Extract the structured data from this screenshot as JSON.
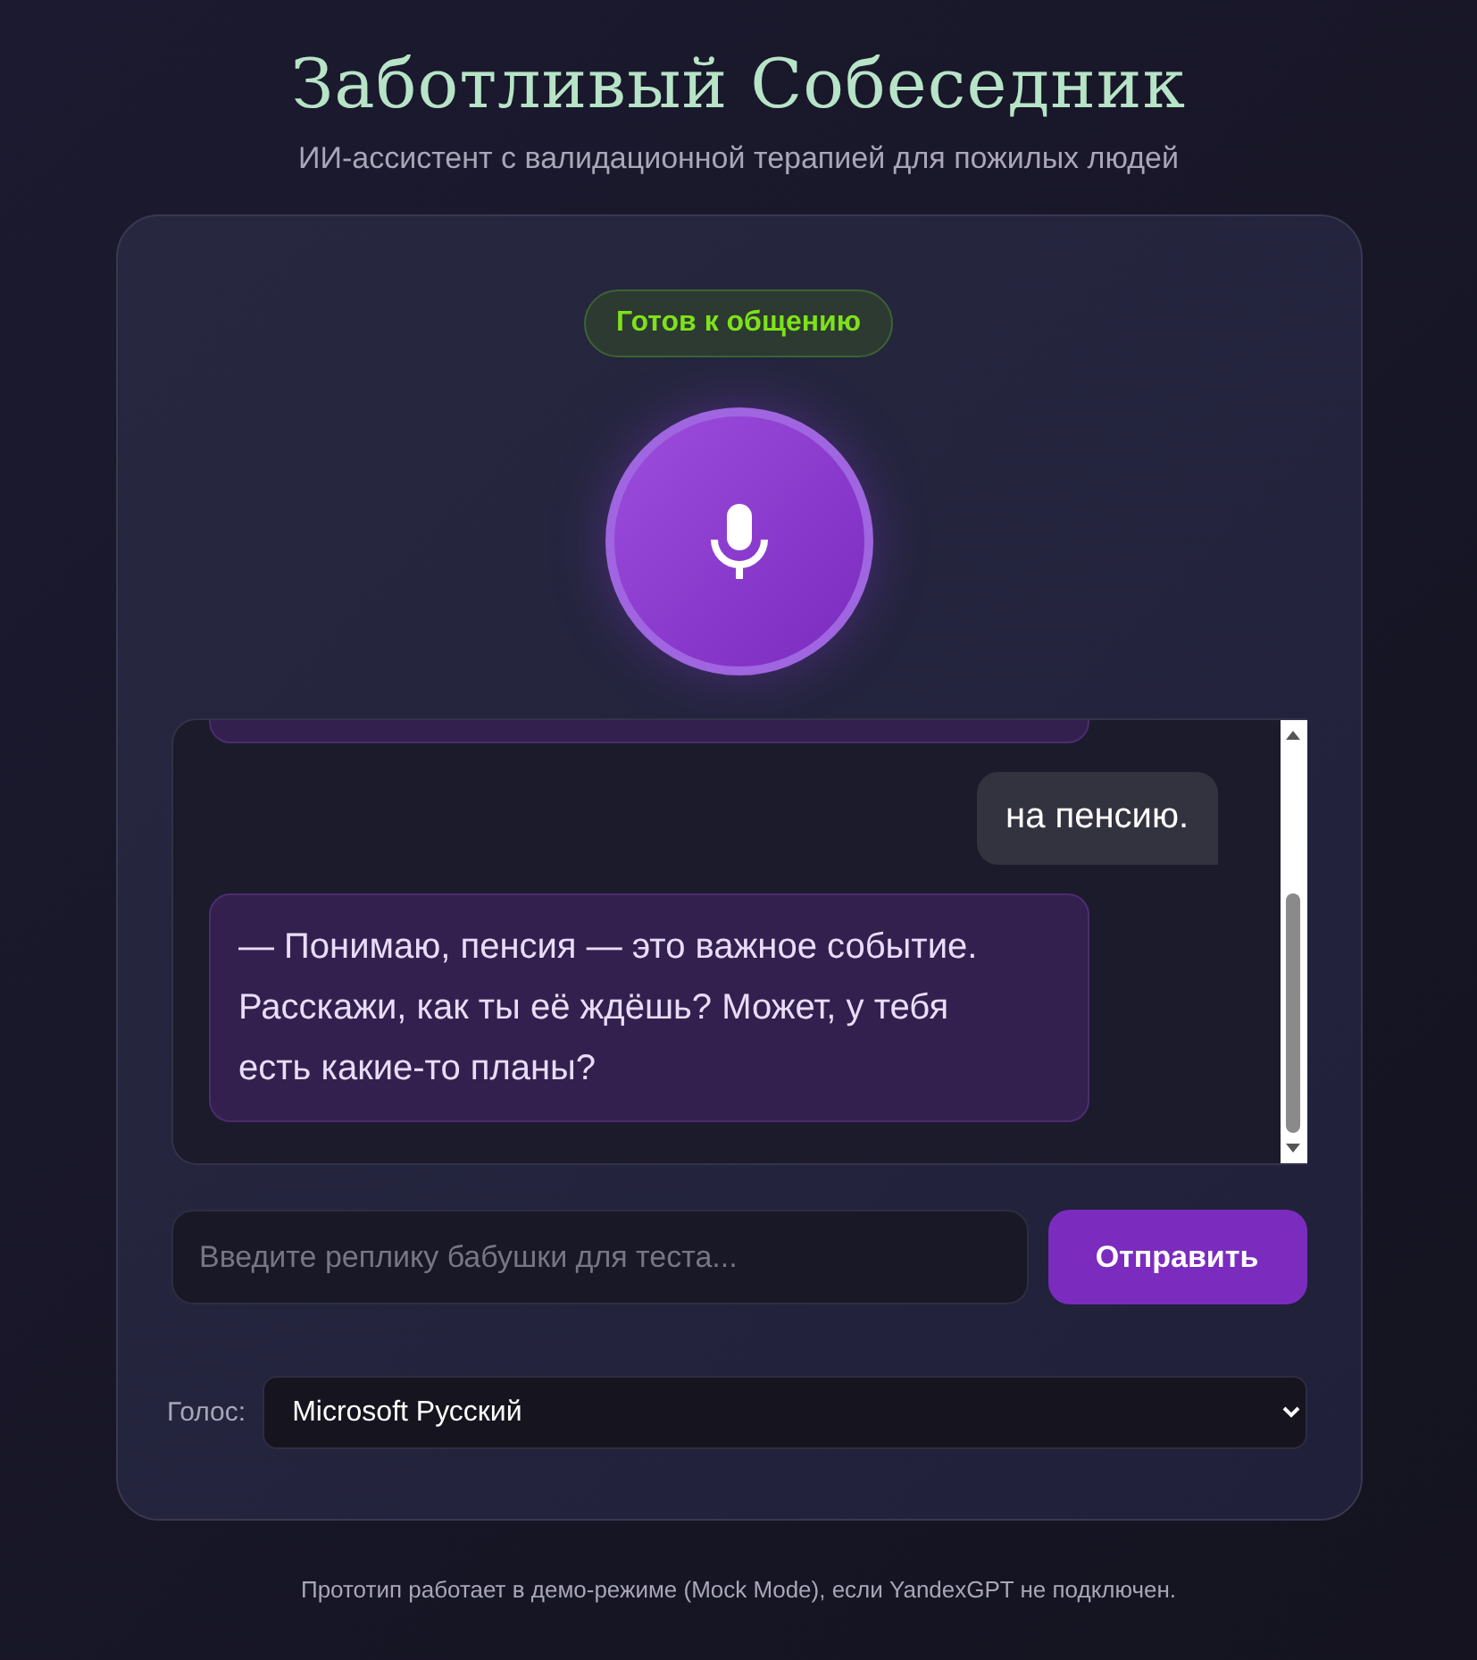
{
  "header": {
    "title": "Заботливый Собеседник",
    "subtitle": "ИИ-ассистент с валидационной терапией для пожилых людей"
  },
  "status": {
    "label": "Готов к общению",
    "kind": "ready"
  },
  "mic": {
    "listening": false
  },
  "messages": [
    {
      "kind": "assistant",
      "clipped": true
    },
    {
      "kind": "user",
      "text": "на пенсию."
    },
    {
      "kind": "assistant",
      "text": "— Понимаю, пенсия — это важное событие. Расскажи, как ты её ждёшь? Может, у тебя есть какие-то планы?"
    }
  ],
  "input": {
    "placeholder": "Введите реплику бабушки для теста...",
    "button": "Отправить"
  },
  "voice": {
    "label": "Голос:",
    "value": "Microsoft Русский"
  },
  "footer": "Прототип работает в демо-режиме (Mock Mode), если YandexGPT не подключен."
}
